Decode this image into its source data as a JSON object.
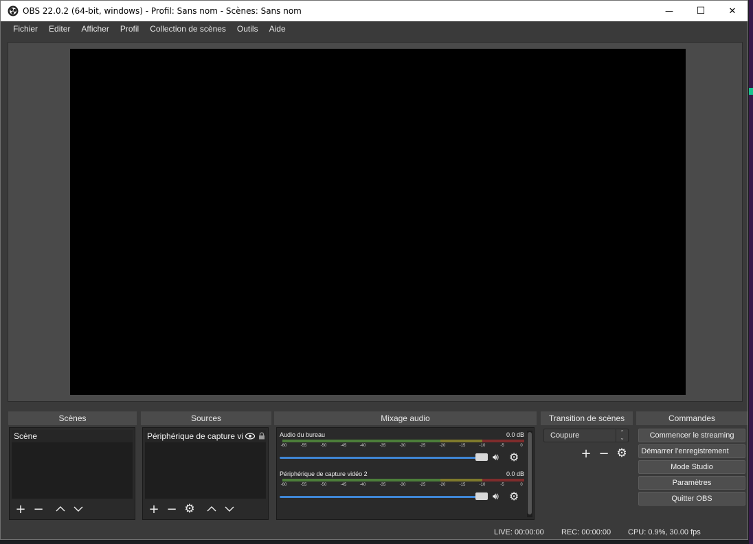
{
  "window": {
    "title": "OBS 22.0.2 (64-bit, windows) - Profil: Sans nom - Scènes: Sans nom",
    "controls": {
      "minimize": "—",
      "maximize": "☐",
      "close": "✕"
    }
  },
  "menu": {
    "items": [
      "Fichier",
      "Editer",
      "Afficher",
      "Profil",
      "Collection de scènes",
      "Outils",
      "Aide"
    ]
  },
  "docks": {
    "scenes": {
      "title": "Scènes",
      "items": [
        "Scène"
      ]
    },
    "sources": {
      "title": "Sources",
      "items": [
        "Périphérique de capture vidéo"
      ]
    },
    "mixer": {
      "title": "Mixage audio",
      "channels": [
        {
          "name": "Audio du bureau",
          "db": "0.0 dB"
        },
        {
          "name": "Périphérique de capture vidéo 2",
          "db": "0.0 dB"
        }
      ],
      "ticks": [
        "-60",
        "-55",
        "-50",
        "-45",
        "-40",
        "-35",
        "-30",
        "-25",
        "-20",
        "-15",
        "-10",
        "-5",
        "0"
      ]
    },
    "transitions": {
      "title": "Transition de scènes",
      "selected": "Coupure"
    },
    "controls": {
      "title": "Commandes",
      "buttons": [
        "Commencer le streaming",
        "Démarrer l'enregistrement",
        "Mode Studio",
        "Paramètres",
        "Quitter OBS"
      ]
    }
  },
  "status": {
    "live": "LIVE: 00:00:00",
    "rec": "REC: 00:00:00",
    "cpu": "CPU: 0.9%, 30.00 fps"
  },
  "colors": {
    "background": "#3a3a3a",
    "preview": "#000000",
    "slider": "#3f86d5",
    "meter_green": "#4c7e3a",
    "meter_yellow": "#7f7a2c",
    "meter_red": "#7f2c2c"
  }
}
